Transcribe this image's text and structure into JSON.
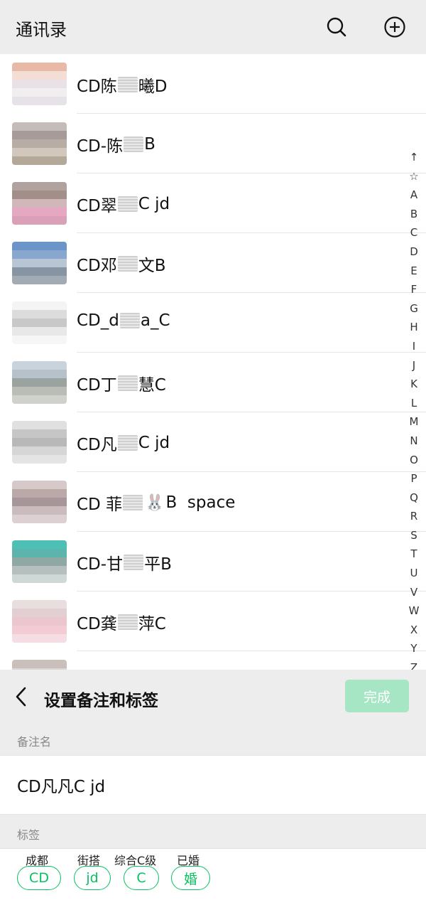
{
  "header": {
    "title": "通讯录",
    "search_icon": "search-icon",
    "add_icon": "add-circle-icon"
  },
  "contacts": [
    {
      "prefix": "CD陈",
      "suffix": "曦D",
      "avatar": [
        "#e8b9a6",
        "#f3ddd4",
        "#e9e1e5",
        "#f1eef0",
        "#e7e2e8"
      ]
    },
    {
      "prefix": "CD-陈",
      "suffix": "B",
      "avatar": [
        "#c4bcb8",
        "#a69b98",
        "#b8ada4",
        "#d2c7bd",
        "#b4a899"
      ]
    },
    {
      "prefix": "CD翠",
      "suffix": "C jd",
      "avatar": [
        "#b0a39f",
        "#a28f89",
        "#d2b7ba",
        "#e6a8c0",
        "#d9a0b7"
      ]
    },
    {
      "prefix": "CD邓",
      "suffix": "文B",
      "avatar": [
        "#6b95c9",
        "#87a7cf",
        "#b7c5d5",
        "#8795a3",
        "#a2aab3"
      ]
    },
    {
      "prefix": "CD_d",
      "suffix": "a_C",
      "avatar": [
        "#f4f4f4",
        "#dcdcdc",
        "#c8c8c8",
        "#e8e8e8",
        "#f6f6f6"
      ]
    },
    {
      "prefix": "CD丁",
      "suffix": "慧C",
      "avatar": [
        "#c9d3dc",
        "#b6c1c9",
        "#9aa39f",
        "#b9bdb6",
        "#cfd2cc"
      ]
    },
    {
      "prefix": "CD凡",
      "suffix": "C jd",
      "avatar": [
        "#e0e0e0",
        "#c6c6c6",
        "#b8b8b8",
        "#d6d6d6",
        "#e4e4e4"
      ]
    },
    {
      "prefix": "CD 菲",
      "emoji": "🐰",
      "suffix": "B  space",
      "avatar": [
        "#d6c9c9",
        "#bba8a9",
        "#a6969a",
        "#cabbbd",
        "#dcd0d2"
      ]
    },
    {
      "prefix": "CD-甘",
      "suffix": "平B",
      "avatar": [
        "#4dbfb4",
        "#5cb5ad",
        "#8fa8a3",
        "#b5bfbd",
        "#cfd8d6"
      ]
    },
    {
      "prefix": "CD龚",
      "suffix": "萍C",
      "avatar": [
        "#e9dede",
        "#e2cfd3",
        "#ecc6cf",
        "#f2cbd5",
        "#f4dde3"
      ]
    },
    {
      "prefix": "",
      "suffix": "",
      "avatar": [
        "#c9c0bc",
        "#ddd6d2",
        "#eeeeee",
        "#ffffff",
        "#ffffff"
      ]
    }
  ],
  "alpha_index": [
    "↑",
    "☆",
    "A",
    "B",
    "C",
    "D",
    "E",
    "F",
    "G",
    "H",
    "I",
    "J",
    "K",
    "L",
    "M",
    "N",
    "O",
    "P",
    "Q",
    "R",
    "S",
    "T",
    "U",
    "V",
    "W",
    "X",
    "Y",
    "Z"
  ],
  "sheet": {
    "back_icon": "chevron-left-icon",
    "title": "设置备注和标签",
    "done_label": "完成",
    "remark_label": "备注名",
    "remark_value": "CD凡凡C jd",
    "tags_label": "标签",
    "tags": [
      {
        "caption": "成都",
        "label": "CD"
      },
      {
        "caption": "街搭",
        "label": "jd"
      },
      {
        "caption": "综合C级",
        "label": "C"
      },
      {
        "caption": "已婚",
        "label": "婚"
      }
    ]
  },
  "colors": {
    "accent": "#07c160",
    "done_disabled": "#a6e6c4",
    "background": "#ededed"
  }
}
